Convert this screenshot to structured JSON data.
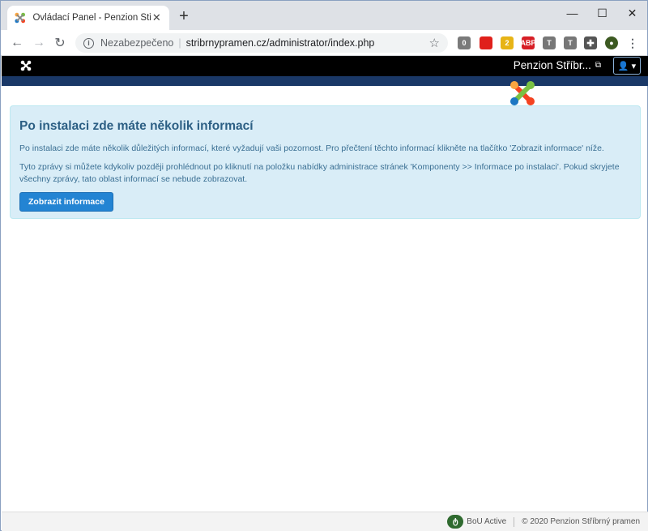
{
  "browser": {
    "tab_title": "Ovládací Panel - Penzion Stříbrný",
    "security_label": "Nezabezpečeno",
    "url": "stribrnypramen.cz/administrator/index.php",
    "extensions": [
      {
        "name": "puzzle-ext",
        "badge": "0",
        "color": "#7a7a7a"
      },
      {
        "name": "opera-ext",
        "badge": "",
        "color": "#e0201b"
      },
      {
        "name": "chat-ext",
        "badge": "2",
        "color": "#e7b416"
      },
      {
        "name": "abp-ext",
        "badge": "ABP",
        "color": "#d71f26"
      },
      {
        "name": "t1-ext",
        "badge": "T",
        "color": "#777777"
      },
      {
        "name": "t2-ext",
        "badge": "T",
        "color": "#777777"
      }
    ]
  },
  "joomla": {
    "site_name": "Penzion Stříbr...",
    "colors": {
      "header": "#000000",
      "subheader": "#1a3867",
      "alert_bg": "#d9edf7",
      "primary_button": "#2384d3"
    }
  },
  "alert": {
    "heading": "Po instalaci zde máte několik informací",
    "paragraph1": "Po instalaci zde máte několik důležitých informací, které vyžadují vaši pozornost. Pro přečtení těchto informací klikněte na tlačítko 'Zobrazit informace' níže.",
    "paragraph2": "Tyto zprávy si můžete kdykoliv později prohlédnout po kliknutí na položku nabídky administrace stránek 'Komponenty >> Informace po instalaci'. Pokud skryjete všechny zprávy, tato oblast informací se nebude zobrazovat.",
    "button_label": "Zobrazit informace"
  },
  "footer": {
    "bou_label": "BoU Active",
    "copyright": "© 2020 Penzion Stříbrný pramen"
  }
}
